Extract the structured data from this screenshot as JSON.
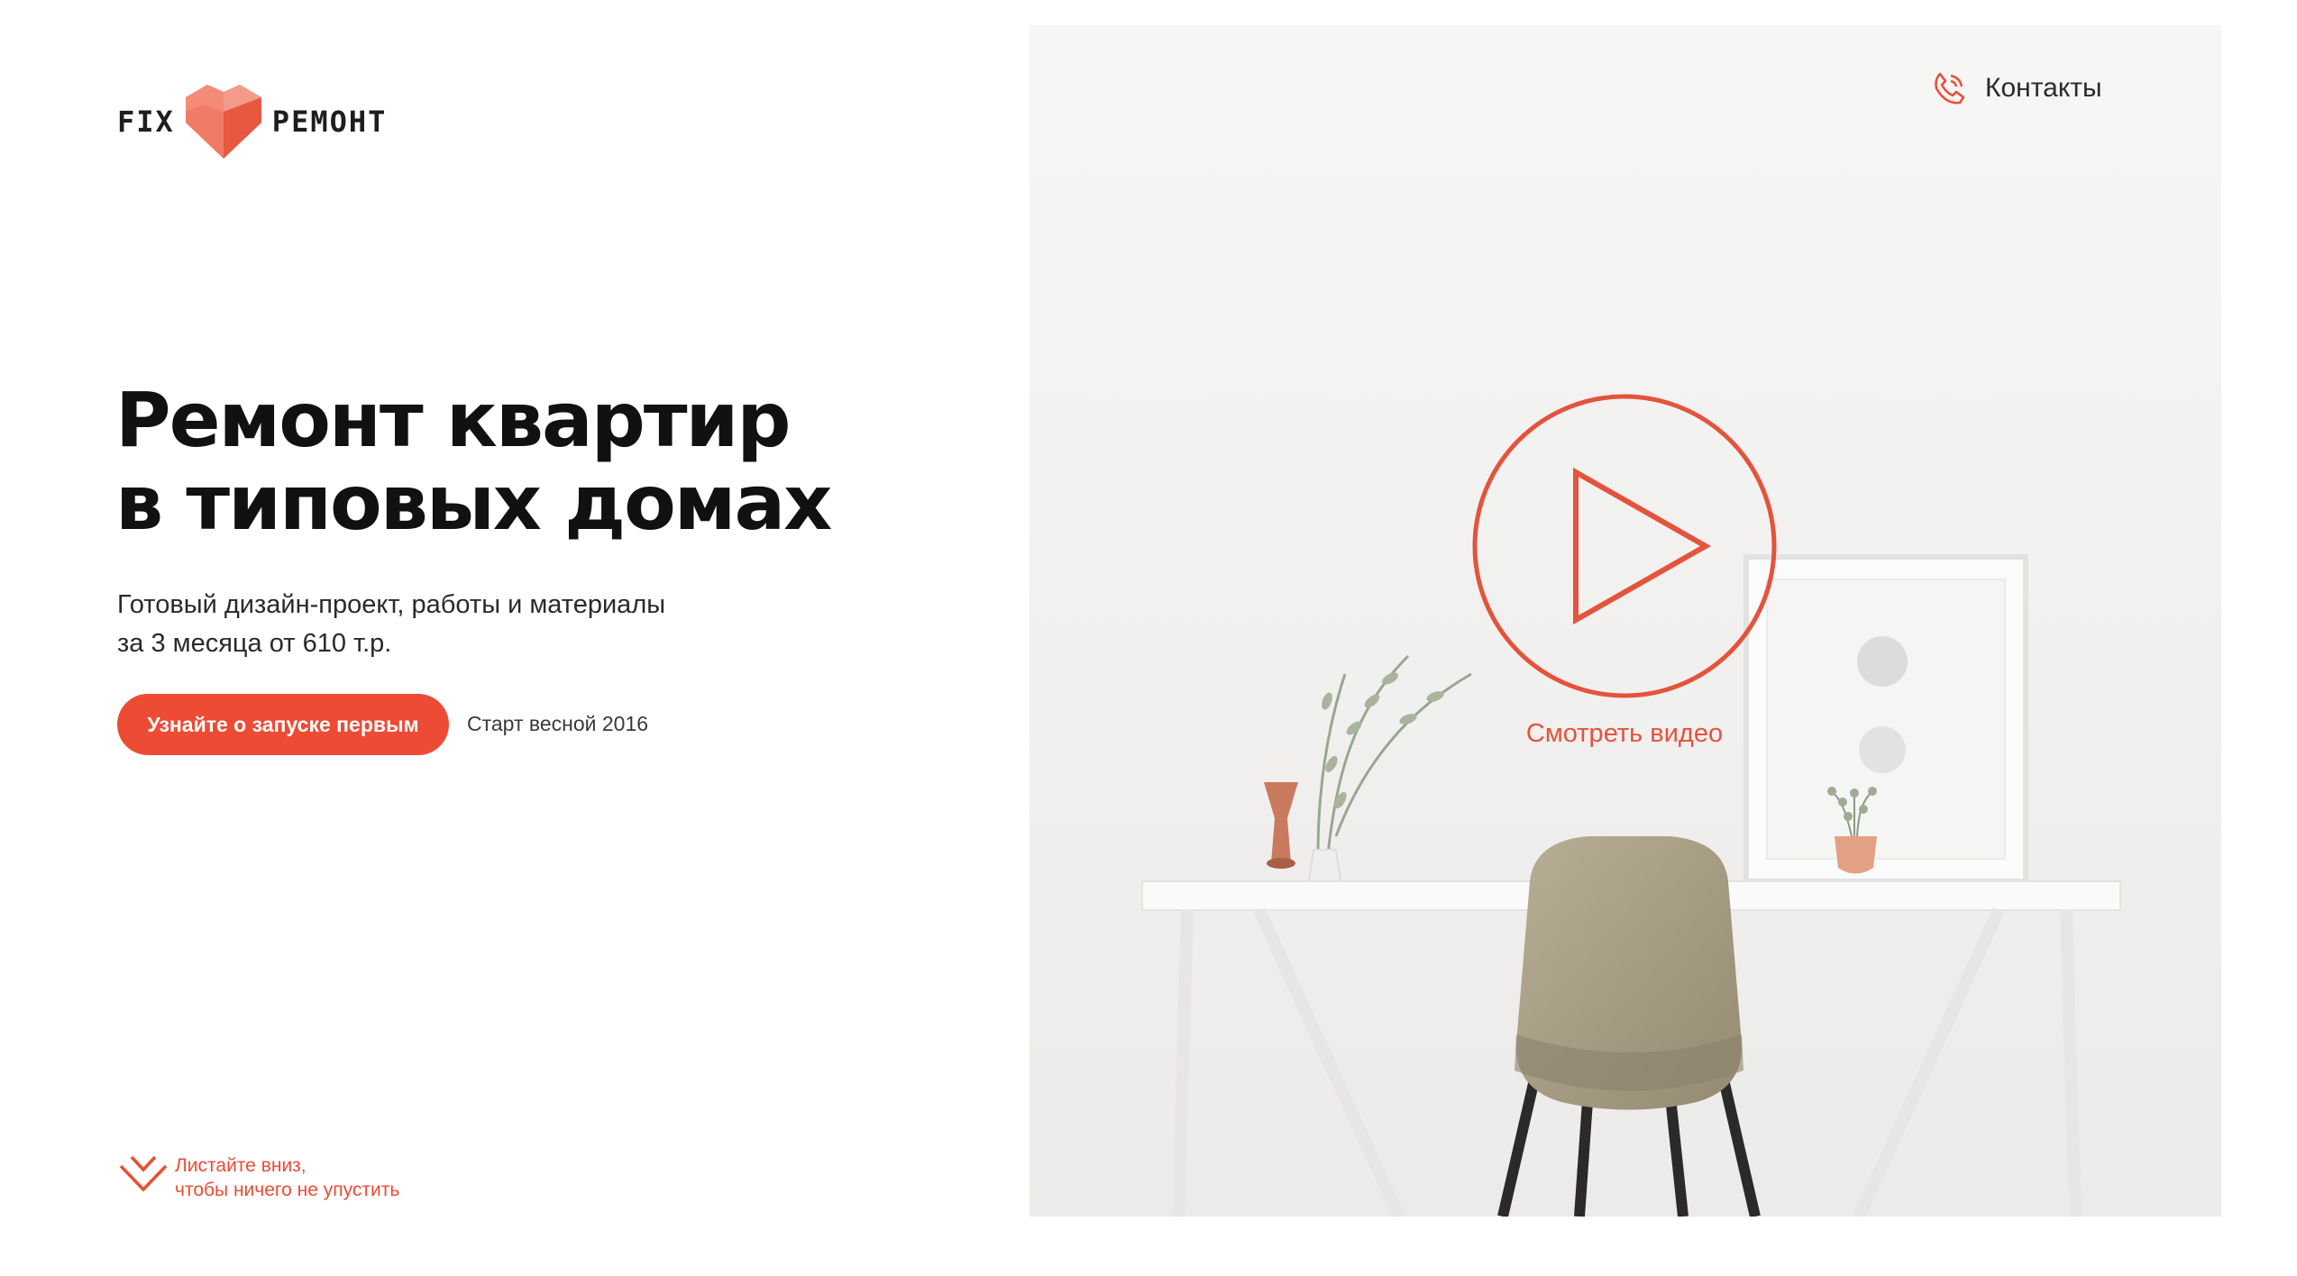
{
  "brand": {
    "left_word": "FIX",
    "right_word": "РЕМОНТ",
    "heart_icon": "heart-cube-icon",
    "accent_color": "#ee4b34"
  },
  "hero": {
    "title_line_1": "Ремонт квартир",
    "title_line_2": "в типовых домах",
    "subtitle_line_1": "Готовый дизайн-проект, работы и материалы",
    "subtitle_line_2": "за 3 месяца от 610 т.р.",
    "cta_label": "Узнайте о запуске первым",
    "start_note": "Старт весной 2016"
  },
  "scroll_hint": {
    "line_1": "Листайте вниз,",
    "line_2": "чтобы ничего не упустить",
    "icon": "chevron-down-icon"
  },
  "media": {
    "contacts_label": "Контакты",
    "contacts_icon": "phone-icon",
    "play_icon": "play-icon",
    "watch_label": "Смотреть видео"
  }
}
